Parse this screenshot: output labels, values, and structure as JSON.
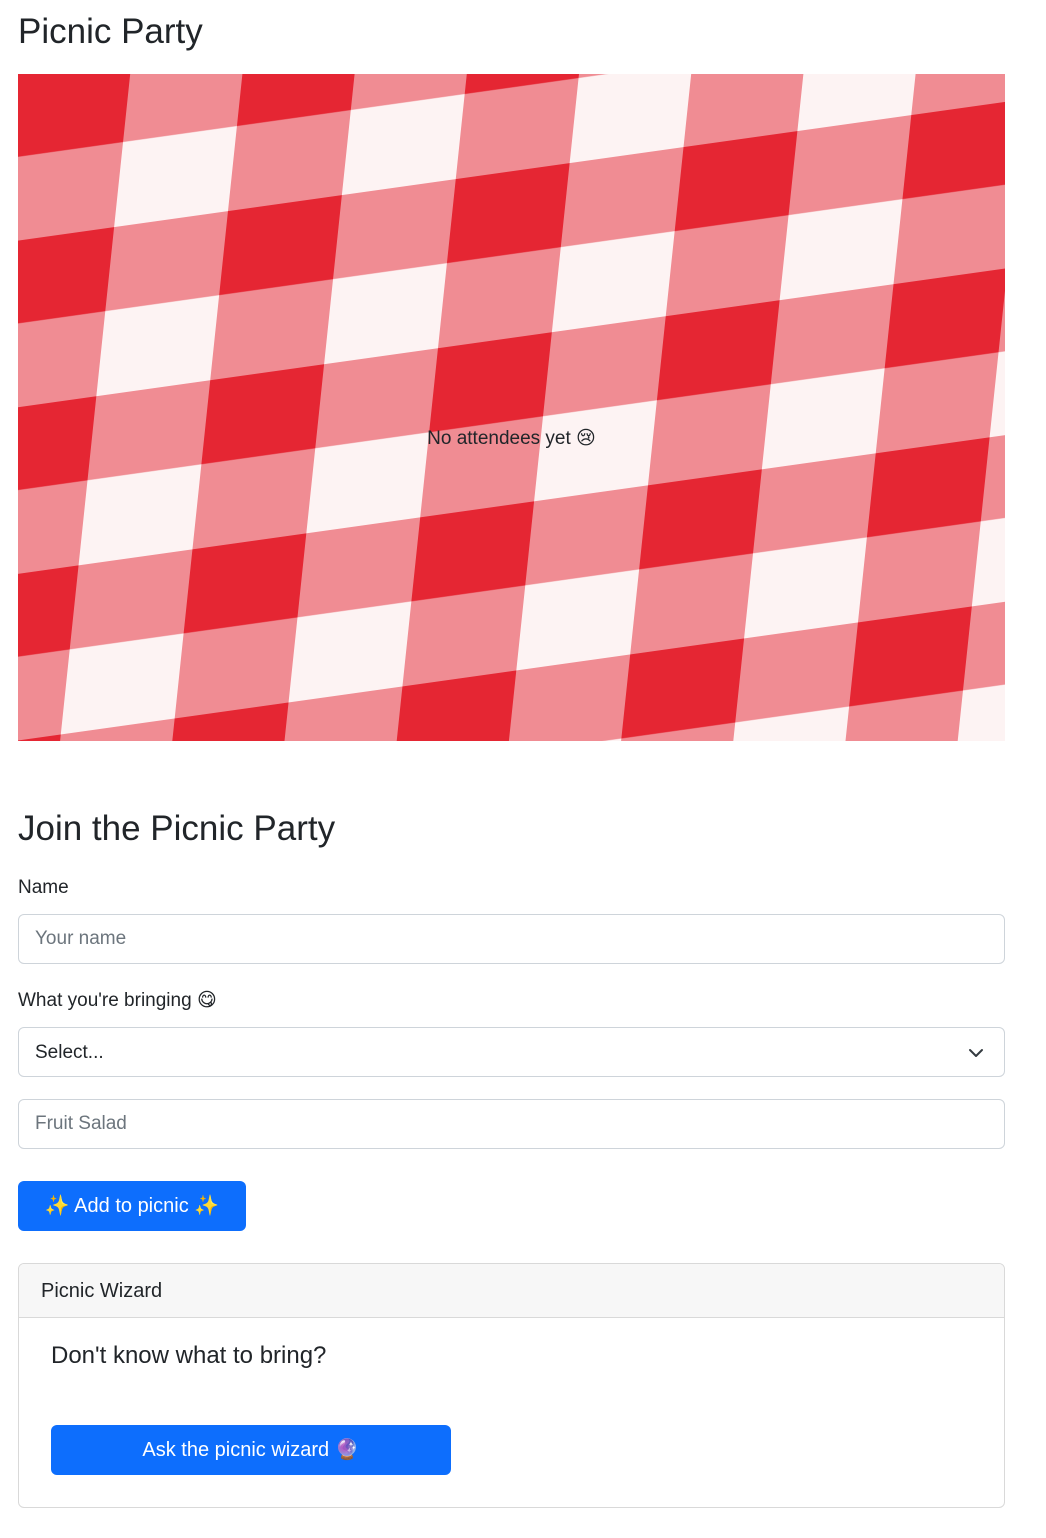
{
  "page": {
    "title": "Picnic Party"
  },
  "attendees": {
    "empty_message": "No attendees yet 😢"
  },
  "form": {
    "heading": "Join the Picnic Party",
    "name_label": "Name",
    "name_placeholder": "Your name",
    "bringing_label": "What you're bringing 😋",
    "bringing_select_value": "Select...",
    "item_placeholder": "Fruit Salad",
    "submit_label": "✨ Add to picnic ✨"
  },
  "wizard": {
    "header": "Picnic Wizard",
    "question": "Don't know what to bring?",
    "button_label": "Ask the picnic wizard 🔮"
  },
  "colors": {
    "primary": "#0d6efd",
    "tablecloth_red": "#e8323d",
    "tablecloth_white": "#fbe9ea"
  }
}
